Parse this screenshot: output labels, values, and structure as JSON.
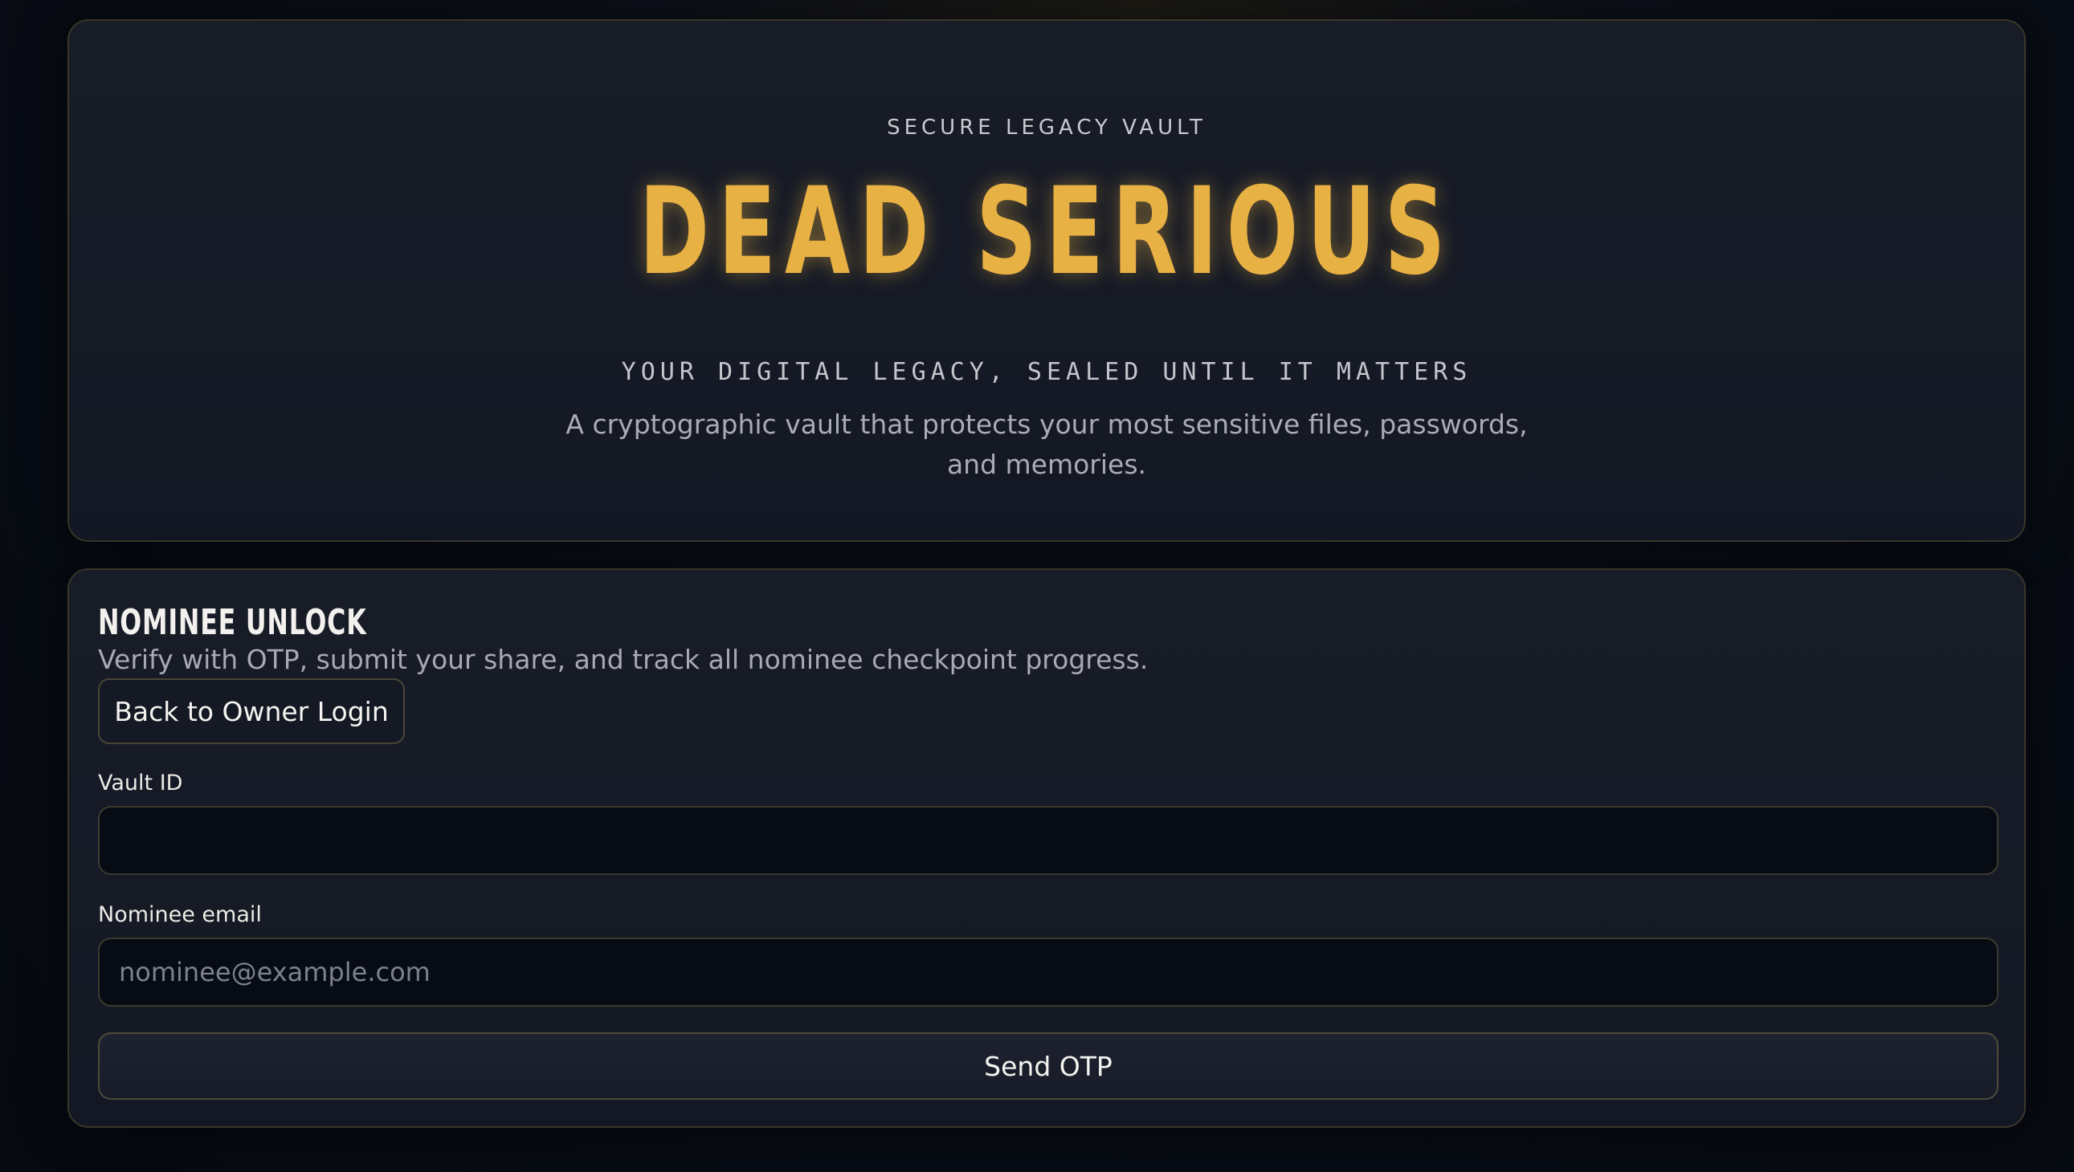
{
  "hero": {
    "kicker": "SECURE LEGACY VAULT",
    "title": "DEAD SERIOUS",
    "tagline": "YOUR DIGITAL LEGACY, SEALED UNTIL IT MATTERS",
    "description": "A cryptographic vault that protects your most sensitive files, passwords, and memories."
  },
  "unlock": {
    "title": "NOMINEE UNLOCK",
    "subtitle": "Verify with OTP, submit your share, and track all nominee checkpoint progress.",
    "back_button": "Back to Owner Login",
    "vault_id": {
      "label": "Vault ID",
      "value": "",
      "placeholder": ""
    },
    "nominee_email": {
      "label": "Nominee email",
      "value": "",
      "placeholder": "nominee@example.com"
    },
    "send_button": "Send OTP"
  },
  "colors": {
    "accent": "#e8b143",
    "background": "#080c14",
    "panel": "#151a25",
    "border": "#3a3629"
  }
}
